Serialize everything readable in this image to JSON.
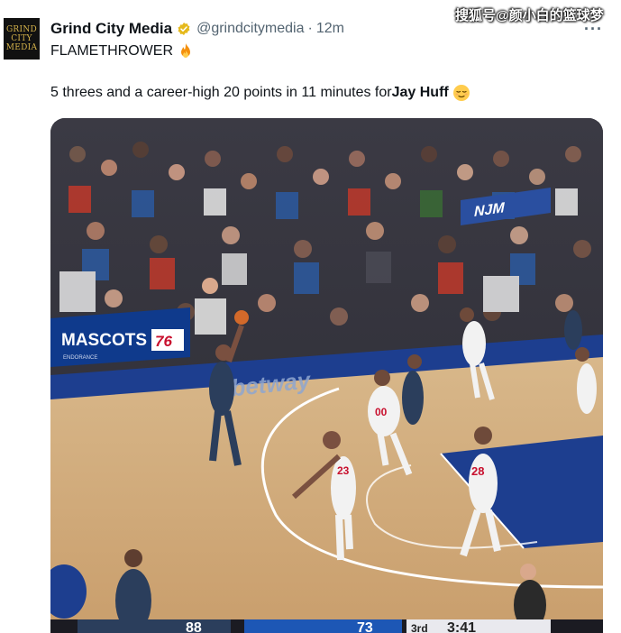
{
  "tweet": {
    "avatar_text": [
      "GRIND",
      "CITY",
      "MEDIA"
    ],
    "author_name": "Grind City Media",
    "handle": "@grindcitymedia",
    "separator": "·",
    "time": "12m",
    "line1": "FLAMETHROWER",
    "line2_prefix": "5 threes and a career-high 20 points in 11 minutes for ",
    "line2_bold": "Jay Huff",
    "more_icon": "more-horizontal-icon",
    "verified_color": "#f4c430"
  },
  "watermark": "搜狐号@颜小白的篮球梦",
  "media": {
    "banner_left": "MASCOTS",
    "banner_sub": "ENDORANCE",
    "banner_logo": "76",
    "courtside_ad": "betway",
    "arena_sign": "NJM",
    "jerseys": [
      "00",
      "23",
      "28"
    ],
    "scoreboard": [
      "88",
      "73",
      "3rd",
      "3:41"
    ]
  }
}
